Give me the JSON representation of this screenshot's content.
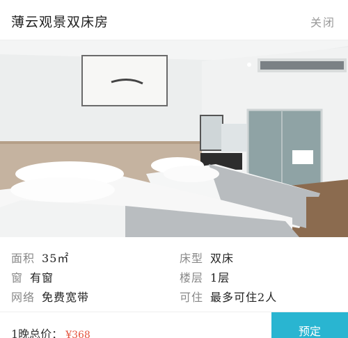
{
  "header": {
    "title": "薄云观景双床房",
    "close_label": "关闭"
  },
  "room": {
    "photo_icon": "hotel-room-photo",
    "details": [
      {
        "label": "面积",
        "value": "35㎡"
      },
      {
        "label": "床型",
        "value": "双床"
      },
      {
        "label": "窗",
        "value": "有窗"
      },
      {
        "label": "楼层",
        "value": "1层"
      },
      {
        "label": "网络",
        "value": "免费宽带"
      },
      {
        "label": "可住",
        "value": "最多可住2人"
      }
    ]
  },
  "footer": {
    "price_label": "1晚总价：",
    "price_value": "¥368",
    "book_label": "预定"
  },
  "colors": {
    "accent": "#29b5d1",
    "price": "#e4523c"
  }
}
